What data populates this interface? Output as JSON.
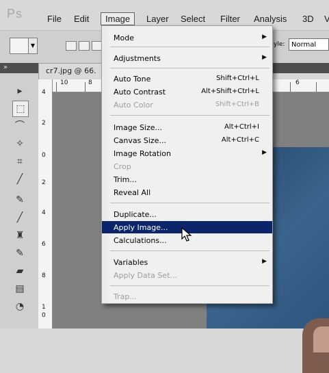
{
  "app": {
    "logo": "Ps",
    "menu": [
      "File",
      "Edit",
      "Image",
      "Layer",
      "Select",
      "Filter",
      "Analysis",
      "3D",
      "V"
    ],
    "active_menu": "Image"
  },
  "options_bar": {
    "style_label": "yle:",
    "style_value": "Normal"
  },
  "document": {
    "tab_title": "cr7.jpg @ 66.",
    "hruler": [
      "10",
      "8",
      "6"
    ],
    "vruler": [
      "4",
      "2",
      "0",
      "2",
      "4",
      "6",
      "8",
      "1",
      "0"
    ]
  },
  "image_menu": {
    "items": [
      {
        "label": "Mode",
        "shortcut": "",
        "submenu": true,
        "disabled": false
      },
      {
        "label": "Adjustments",
        "shortcut": "",
        "submenu": true,
        "disabled": false
      },
      {
        "label": "Auto Tone",
        "shortcut": "Shift+Ctrl+L",
        "submenu": false,
        "disabled": false
      },
      {
        "label": "Auto Contrast",
        "shortcut": "Alt+Shift+Ctrl+L",
        "submenu": false,
        "disabled": false
      },
      {
        "label": "Auto Color",
        "shortcut": "Shift+Ctrl+B",
        "submenu": false,
        "disabled": true
      },
      {
        "label": "Image Size...",
        "shortcut": "Alt+Ctrl+I",
        "submenu": false,
        "disabled": false
      },
      {
        "label": "Canvas Size...",
        "shortcut": "Alt+Ctrl+C",
        "submenu": false,
        "disabled": false
      },
      {
        "label": "Image Rotation",
        "shortcut": "",
        "submenu": true,
        "disabled": false
      },
      {
        "label": "Crop",
        "shortcut": "",
        "submenu": false,
        "disabled": true
      },
      {
        "label": "Trim...",
        "shortcut": "",
        "submenu": false,
        "disabled": false
      },
      {
        "label": "Reveal All",
        "shortcut": "",
        "submenu": false,
        "disabled": false
      },
      {
        "label": "Duplicate...",
        "shortcut": "",
        "submenu": false,
        "disabled": false
      },
      {
        "label": "Apply Image...",
        "shortcut": "",
        "submenu": false,
        "disabled": false
      },
      {
        "label": "Calculations...",
        "shortcut": "",
        "submenu": false,
        "disabled": false
      },
      {
        "label": "Variables",
        "shortcut": "",
        "submenu": true,
        "disabled": false
      },
      {
        "label": "Apply Data Set...",
        "shortcut": "",
        "submenu": false,
        "disabled": true
      },
      {
        "label": "Trap...",
        "shortcut": "",
        "submenu": false,
        "disabled": true
      }
    ],
    "highlighted": "Apply Image..."
  }
}
